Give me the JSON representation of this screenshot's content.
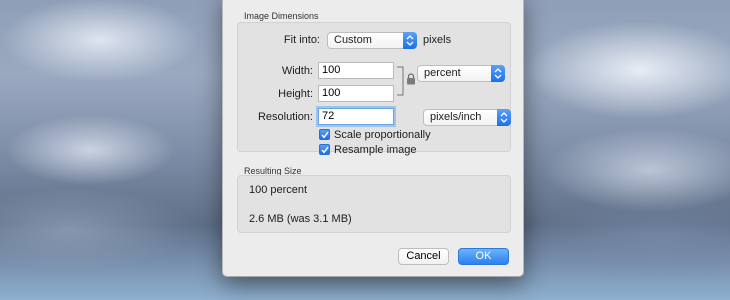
{
  "dimensions": {
    "section_label": "Image Dimensions",
    "fit_into_label": "Fit into:",
    "fit_into_value": "Custom",
    "fit_into_unit": "pixels",
    "width_label": "Width:",
    "width_value": "100",
    "height_label": "Height:",
    "height_value": "100",
    "size_unit_value": "percent",
    "resolution_label": "Resolution:",
    "resolution_value": "72",
    "resolution_unit_value": "pixels/inch",
    "scale_label": "Scale proportionally",
    "scale_checked": true,
    "resample_label": "Resample image",
    "resample_checked": true
  },
  "resulting": {
    "section_label": "Resulting Size",
    "percent_text": "100 percent",
    "size_text": "2.6 MB (was 3.1 MB)"
  },
  "buttons": {
    "cancel_label": "Cancel",
    "ok_label": "OK"
  },
  "colors": {
    "accent": "#2a82f0",
    "focus_ring": "#9cc4ef"
  }
}
